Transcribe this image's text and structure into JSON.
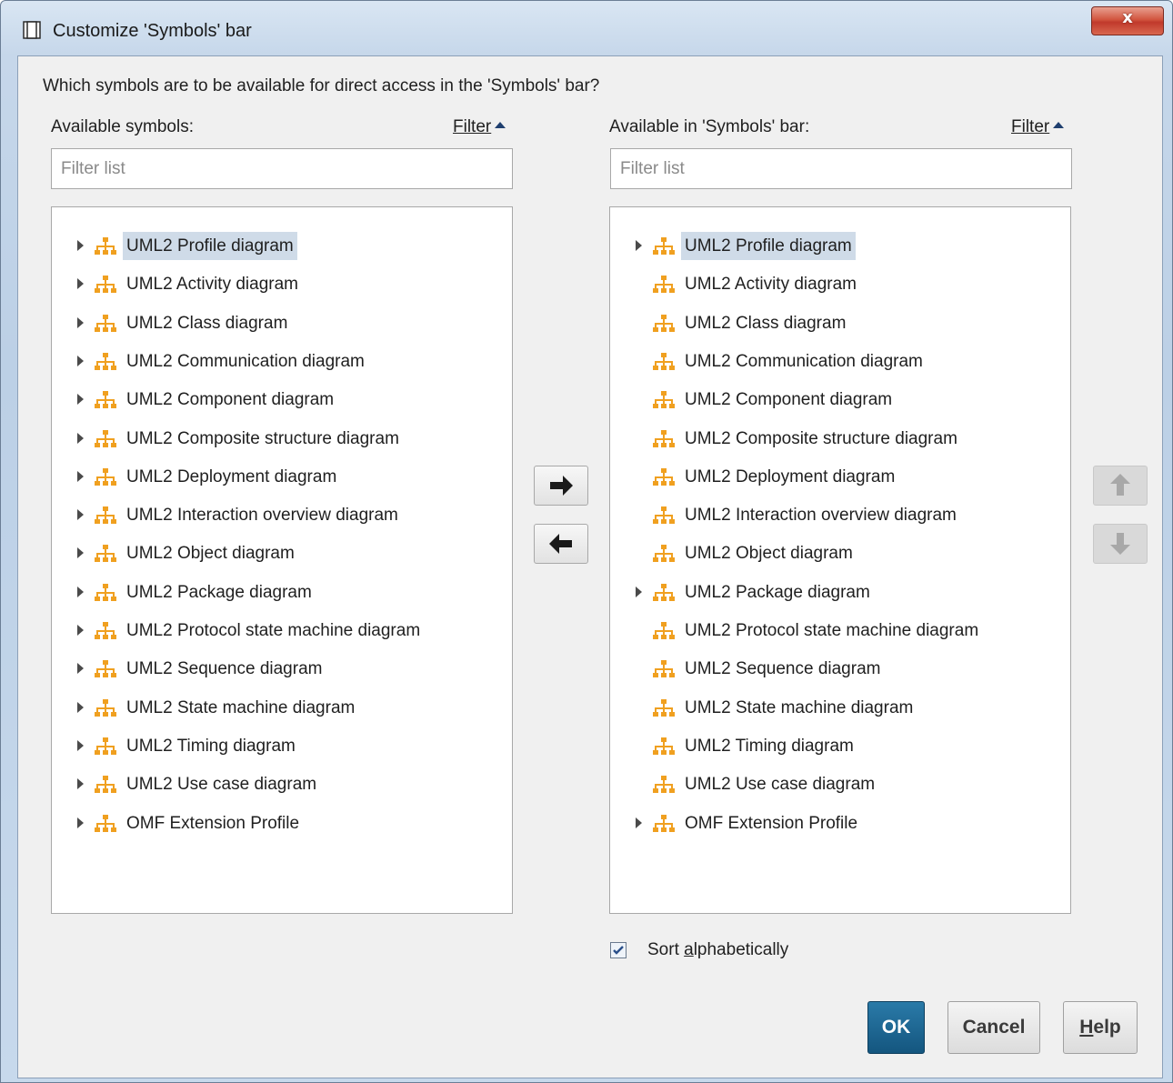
{
  "window": {
    "title": "Customize 'Symbols' bar",
    "close_label": "x"
  },
  "question": "Which symbols are to be available for direct access in the 'Symbols' bar?",
  "left": {
    "label": "Available symbols:",
    "filter_link": "Filter",
    "filter_placeholder": "Filter list",
    "items": [
      {
        "label": "UML2 Profile diagram",
        "expandable": true,
        "selected": true
      },
      {
        "label": "UML2 Activity diagram",
        "expandable": true,
        "selected": false
      },
      {
        "label": "UML2 Class diagram",
        "expandable": true,
        "selected": false
      },
      {
        "label": "UML2 Communication diagram",
        "expandable": true,
        "selected": false
      },
      {
        "label": "UML2 Component diagram",
        "expandable": true,
        "selected": false
      },
      {
        "label": "UML2 Composite structure diagram",
        "expandable": true,
        "selected": false
      },
      {
        "label": "UML2 Deployment diagram",
        "expandable": true,
        "selected": false
      },
      {
        "label": "UML2 Interaction overview diagram",
        "expandable": true,
        "selected": false
      },
      {
        "label": "UML2 Object diagram",
        "expandable": true,
        "selected": false
      },
      {
        "label": "UML2 Package diagram",
        "expandable": true,
        "selected": false
      },
      {
        "label": "UML2 Protocol state machine diagram",
        "expandable": true,
        "selected": false
      },
      {
        "label": "UML2 Sequence diagram",
        "expandable": true,
        "selected": false
      },
      {
        "label": "UML2 State machine diagram",
        "expandable": true,
        "selected": false
      },
      {
        "label": "UML2 Timing diagram",
        "expandable": true,
        "selected": false
      },
      {
        "label": "UML2 Use case diagram",
        "expandable": true,
        "selected": false
      },
      {
        "label": "OMF Extension Profile",
        "expandable": true,
        "selected": false
      }
    ]
  },
  "right": {
    "label": "Available in 'Symbols' bar:",
    "filter_link": "Filter",
    "filter_placeholder": "Filter list",
    "items": [
      {
        "label": "UML2 Profile diagram",
        "expandable": true,
        "selected": true
      },
      {
        "label": "UML2 Activity diagram",
        "expandable": false,
        "selected": false
      },
      {
        "label": "UML2 Class diagram",
        "expandable": false,
        "selected": false
      },
      {
        "label": "UML2 Communication diagram",
        "expandable": false,
        "selected": false
      },
      {
        "label": "UML2 Component diagram",
        "expandable": false,
        "selected": false
      },
      {
        "label": "UML2 Composite structure diagram",
        "expandable": false,
        "selected": false
      },
      {
        "label": "UML2 Deployment diagram",
        "expandable": false,
        "selected": false
      },
      {
        "label": "UML2 Interaction overview diagram",
        "expandable": false,
        "selected": false
      },
      {
        "label": "UML2 Object diagram",
        "expandable": false,
        "selected": false
      },
      {
        "label": "UML2 Package diagram",
        "expandable": true,
        "selected": false
      },
      {
        "label": "UML2 Protocol state machine diagram",
        "expandable": false,
        "selected": false
      },
      {
        "label": "UML2 Sequence diagram",
        "expandable": false,
        "selected": false
      },
      {
        "label": "UML2 State machine diagram",
        "expandable": false,
        "selected": false
      },
      {
        "label": "UML2 Timing diagram",
        "expandable": false,
        "selected": false
      },
      {
        "label": "UML2 Use case diagram",
        "expandable": false,
        "selected": false
      },
      {
        "label": "OMF Extension Profile",
        "expandable": true,
        "selected": false
      }
    ]
  },
  "icons": {
    "diagram_item": "diagram-hierarchy-icon",
    "add": "arrow-right-icon",
    "remove": "arrow-left-icon",
    "move_up": "arrow-up-icon",
    "move_down": "arrow-down-icon"
  },
  "sort": {
    "checked": true,
    "label_before": "Sort ",
    "label_mnemonic": "a",
    "label_after": "lphabetically"
  },
  "buttons": {
    "ok": "OK",
    "cancel": "Cancel",
    "help_mnemonic": "H",
    "help_rest": "elp"
  },
  "colors": {
    "icon_orange": "#f0a020",
    "selection": "#cfdbe8",
    "ok_button": "#1a6592",
    "close_button": "#c9462f"
  }
}
